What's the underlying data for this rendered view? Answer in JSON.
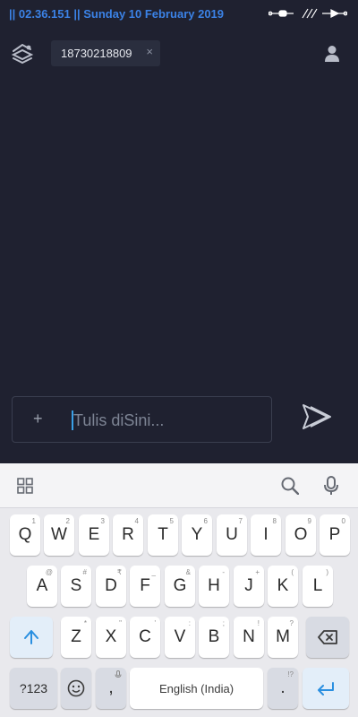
{
  "status_bar": {
    "text": "|| 02.36.151 || Sunday 10 February 2019"
  },
  "header": {
    "chip_label": "18730218809",
    "chip_close": "×"
  },
  "composer": {
    "plus": "+",
    "placeholder": "Tulis diSini..."
  },
  "keyboard": {
    "row1": [
      {
        "label": "Q",
        "hint": "1"
      },
      {
        "label": "W",
        "hint": "2"
      },
      {
        "label": "E",
        "hint": "3"
      },
      {
        "label": "R",
        "hint": "4"
      },
      {
        "label": "T",
        "hint": "5"
      },
      {
        "label": "Y",
        "hint": "6"
      },
      {
        "label": "U",
        "hint": "7"
      },
      {
        "label": "I",
        "hint": "8"
      },
      {
        "label": "O",
        "hint": "9"
      },
      {
        "label": "P",
        "hint": "0"
      }
    ],
    "row2": [
      {
        "label": "A",
        "hint": "@"
      },
      {
        "label": "S",
        "hint": "#"
      },
      {
        "label": "D",
        "hint": "₹"
      },
      {
        "label": "F",
        "hint": "_"
      },
      {
        "label": "G",
        "hint": "&"
      },
      {
        "label": "H",
        "hint": "-"
      },
      {
        "label": "J",
        "hint": "+"
      },
      {
        "label": "K",
        "hint": "("
      },
      {
        "label": "L",
        "hint": ")"
      }
    ],
    "row3": [
      {
        "label": "Z",
        "hint": "*"
      },
      {
        "label": "X",
        "hint": "\""
      },
      {
        "label": "C",
        "hint": "'"
      },
      {
        "label": "V",
        "hint": ":"
      },
      {
        "label": "B",
        "hint": ";"
      },
      {
        "label": "N",
        "hint": "!"
      },
      {
        "label": "M",
        "hint": "?"
      }
    ],
    "symbols_key": "?123",
    "comma_key": ",",
    "space_key": "English (India)",
    "period_key": ".",
    "period_hint": "!?"
  },
  "icons": {
    "app_logo": "layers-logo-icon",
    "profile": "person-icon",
    "send": "send-icon",
    "grid": "grid-icon",
    "search": "search-icon",
    "mic": "microphone-icon",
    "shift": "shift-arrow-icon",
    "backspace": "backspace-icon",
    "emoji": "emoji-icon",
    "enter": "enter-icon"
  },
  "colors": {
    "background": "#1f2130",
    "status_accent": "#3b82e6",
    "keyboard_bg": "#e9e9ed",
    "key_accent": "#2a8fe0"
  }
}
